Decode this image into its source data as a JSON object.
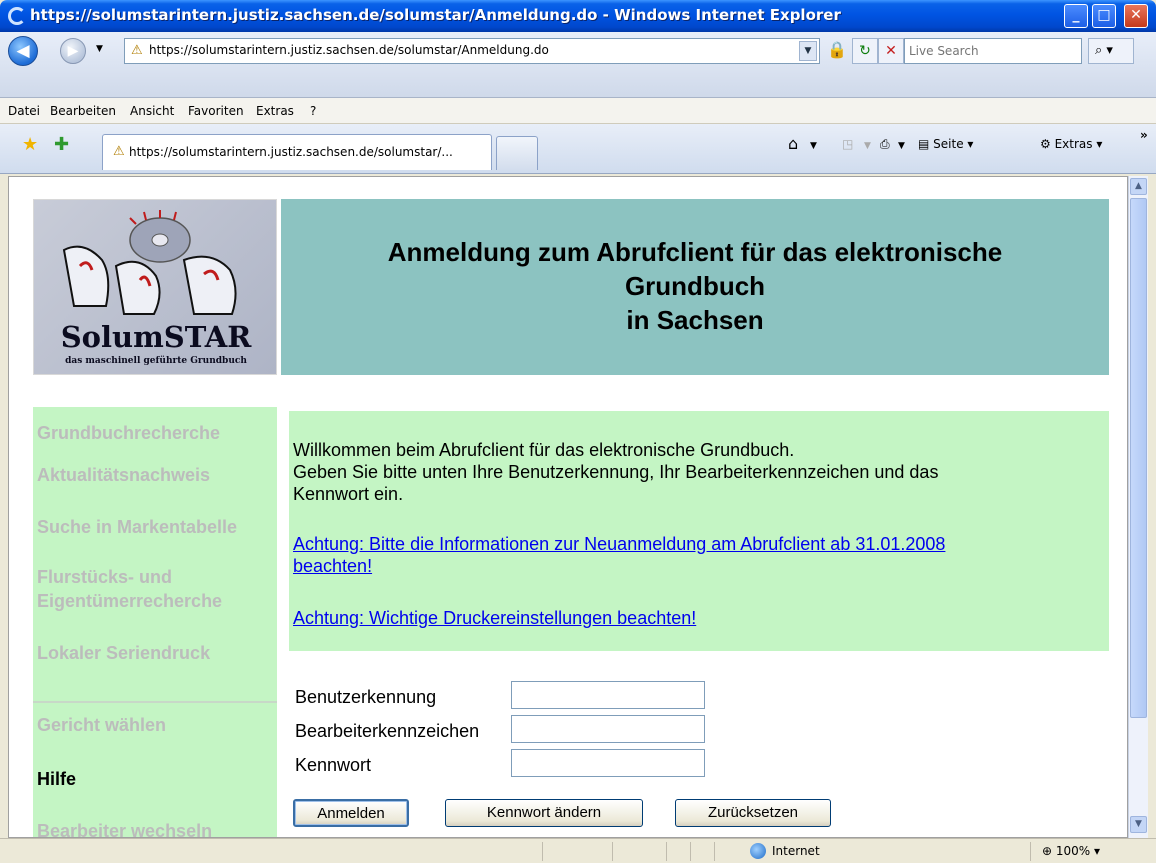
{
  "window": {
    "title": "https://solumstarintern.justiz.sachsen.de/solumstar/Anmeldung.do - Windows Internet Explorer",
    "minimize": "_",
    "maximize": "□",
    "close": "✕"
  },
  "address_bar": {
    "url": "https://solumstarintern.justiz.sachsen.de/solumstar/Anmeldung.do",
    "search_placeholder": "Live Search"
  },
  "menu": [
    "Datei",
    "Bearbeiten",
    "Ansicht",
    "Favoriten",
    "Extras",
    "?"
  ],
  "tab": {
    "title": "https://solumstarintern.justiz.sachsen.de/solumstar/..."
  },
  "command_bar": {
    "page_label": "Seite",
    "tools_label": "Extras"
  },
  "header": {
    "brand": "SolumSTAR",
    "tagline": "das maschinell geführte Grundbuch",
    "title_line1": "Anmeldung zum Abrufclient für das elektronische",
    "title_line2": "Grundbuch",
    "title_line3": "in Sachsen"
  },
  "nav": {
    "items": [
      {
        "label": "Grundbuchrecherche",
        "active": false
      },
      {
        "label": "Aktualitätsnachweis",
        "active": false
      },
      {
        "label": "Suche in Markentabelle",
        "active": false
      },
      {
        "label": "Flurstücks- und",
        "active": false
      },
      {
        "label": "Eigentümerrecherche",
        "active": false
      },
      {
        "label": "Lokaler Seriendruck",
        "active": false
      },
      {
        "label": "Gericht wählen",
        "active": false
      },
      {
        "label": "Hilfe",
        "active": true
      },
      {
        "label": "Bearbeiter wechseln",
        "active": false
      }
    ]
  },
  "info": {
    "welcome": "Willkommen beim Abrufclient für das elektronische Grundbuch.",
    "instruction_line1": "Geben Sie bitte unten Ihre Benutzerkennung, Ihr Bearbeiterkennzeichen und das",
    "instruction_line2": "Kennwort ein.",
    "link1_line1": "Achtung: Bitte die Informationen zur Neuanmeldung am Abrufclient ab 31.01.2008",
    "link1_line2": "beachten!",
    "link2": "Achtung: Wichtige Druckereinstellungen beachten!"
  },
  "form": {
    "user_label": "Benutzerkennung",
    "user_value": "",
    "editor_label": "Bearbeiterkennzeichen",
    "editor_value": "",
    "password_label": "Kennwort",
    "password_value": "",
    "login_button": "Anmelden",
    "change_password_button": "Kennwort ändern",
    "reset_button": "Zurücksetzen"
  },
  "status_bar": {
    "zone": "Internet",
    "zoom": "100%"
  },
  "colors": {
    "header_bg": "#8cc3c1",
    "nav_bg": "#c4f5c4",
    "link": "#0000ee",
    "nav_inactive": "#bcbcbc"
  }
}
